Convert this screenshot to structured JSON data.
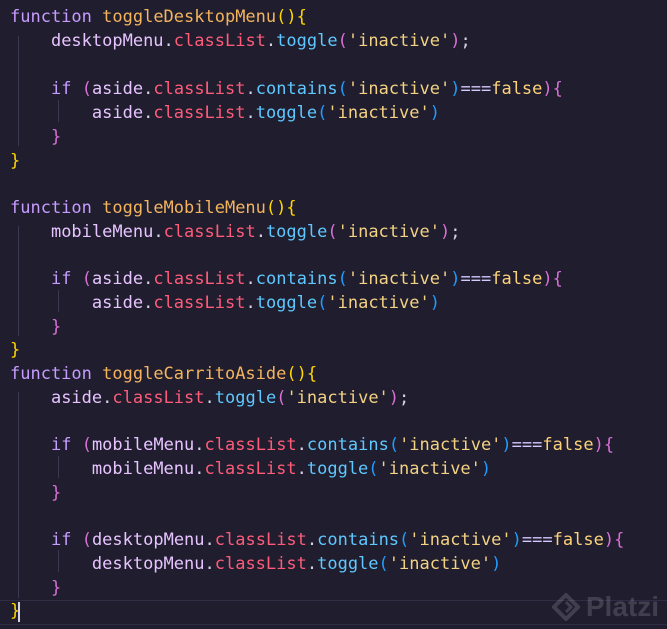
{
  "code": {
    "lines": [
      "function toggleDesktopMenu(){",
      "    desktopMenu.classList.toggle('inactive');",
      "",
      "    if (aside.classList.contains('inactive')===false){",
      "        aside.classList.toggle('inactive')",
      "    }",
      "}",
      "",
      "function toggleMobileMenu(){",
      "    mobileMenu.classList.toggle('inactive');",
      "",
      "    if (aside.classList.contains('inactive')===false){",
      "        aside.classList.toggle('inactive')",
      "    }",
      "}",
      "function toggleCarritoAside(){",
      "    aside.classList.toggle('inactive');",
      "",
      "    if (mobileMenu.classList.contains('inactive')===false){",
      "        mobileMenu.classList.toggle('inactive')",
      "    }",
      "",
      "    if (desktopMenu.classList.contains('inactive')===false){",
      "        desktopMenu.classList.toggle('inactive')",
      "    }",
      "}"
    ]
  },
  "watermark": {
    "text": "Platzi",
    "icon": "platzi-logo-icon"
  },
  "colors": {
    "background": "#1f1d2e",
    "keyword": "#c79cff",
    "function_name": "#f4b45e",
    "property": "#ff5c7a",
    "method": "#5ec8ff",
    "string": "#f3d283",
    "identifier": "#e7c4ff"
  }
}
